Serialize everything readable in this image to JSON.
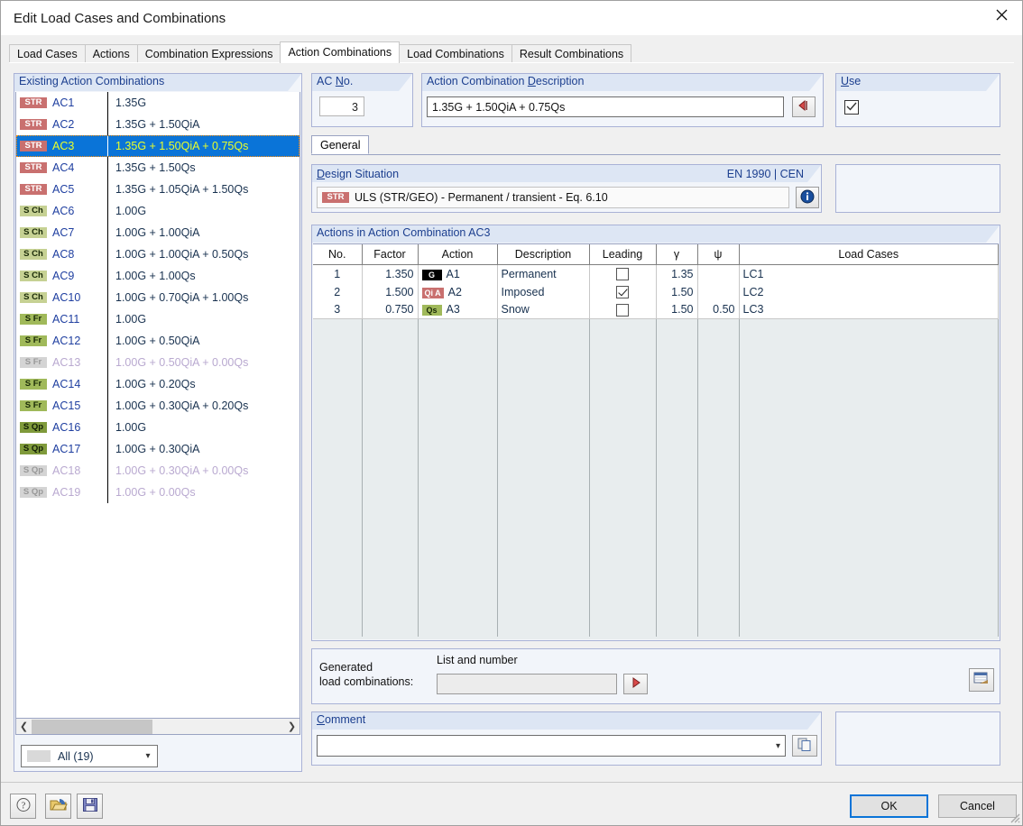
{
  "window": {
    "title": "Edit Load Cases and Combinations",
    "close_icon": "close-icon"
  },
  "tabs": [
    {
      "label": "Load Cases",
      "active": false
    },
    {
      "label": "Actions",
      "active": false
    },
    {
      "label": "Combination Expressions",
      "active": false
    },
    {
      "label": "Action Combinations",
      "active": true
    },
    {
      "label": "Load Combinations",
      "active": false
    },
    {
      "label": "Result Combinations",
      "active": false
    }
  ],
  "existing_panel": {
    "title": "Existing Action Combinations",
    "rows": [
      {
        "badge": "STR",
        "badge_kind": "str",
        "id": "AC1",
        "expr": "1.35G",
        "selected": false,
        "dim": false
      },
      {
        "badge": "STR",
        "badge_kind": "str",
        "id": "AC2",
        "expr": "1.35G + 1.50QiA",
        "selected": false,
        "dim": false
      },
      {
        "badge": "STR",
        "badge_kind": "str",
        "id": "AC3",
        "expr": "1.35G + 1.50QiA + 0.75Qs",
        "selected": true,
        "dim": false
      },
      {
        "badge": "STR",
        "badge_kind": "str",
        "id": "AC4",
        "expr": "1.35G + 1.50Qs",
        "selected": false,
        "dim": false
      },
      {
        "badge": "STR",
        "badge_kind": "str",
        "id": "AC5",
        "expr": "1.35G + 1.05QiA + 1.50Qs",
        "selected": false,
        "dim": false
      },
      {
        "badge": "S Ch",
        "badge_kind": "sch",
        "id": "AC6",
        "expr": "1.00G",
        "selected": false,
        "dim": false
      },
      {
        "badge": "S Ch",
        "badge_kind": "sch",
        "id": "AC7",
        "expr": "1.00G + 1.00QiA",
        "selected": false,
        "dim": false
      },
      {
        "badge": "S Ch",
        "badge_kind": "sch",
        "id": "AC8",
        "expr": "1.00G + 1.00QiA + 0.50Qs",
        "selected": false,
        "dim": false
      },
      {
        "badge": "S Ch",
        "badge_kind": "sch",
        "id": "AC9",
        "expr": "1.00G + 1.00Qs",
        "selected": false,
        "dim": false
      },
      {
        "badge": "S Ch",
        "badge_kind": "sch",
        "id": "AC10",
        "expr": "1.00G + 0.70QiA + 1.00Qs",
        "selected": false,
        "dim": false
      },
      {
        "badge": "S Fr",
        "badge_kind": "sfr",
        "id": "AC11",
        "expr": "1.00G",
        "selected": false,
        "dim": false
      },
      {
        "badge": "S Fr",
        "badge_kind": "sfr",
        "id": "AC12",
        "expr": "1.00G + 0.50QiA",
        "selected": false,
        "dim": false
      },
      {
        "badge": "S Fr",
        "badge_kind": "gray",
        "id": "AC13",
        "expr": "1.00G + 0.50QiA + 0.00Qs",
        "selected": false,
        "dim": true
      },
      {
        "badge": "S Fr",
        "badge_kind": "sfr",
        "id": "AC14",
        "expr": "1.00G + 0.20Qs",
        "selected": false,
        "dim": false
      },
      {
        "badge": "S Fr",
        "badge_kind": "sfr",
        "id": "AC15",
        "expr": "1.00G + 0.30QiA + 0.20Qs",
        "selected": false,
        "dim": false
      },
      {
        "badge": "S Qp",
        "badge_kind": "sqp",
        "id": "AC16",
        "expr": "1.00G",
        "selected": false,
        "dim": false
      },
      {
        "badge": "S Qp",
        "badge_kind": "sqp",
        "id": "AC17",
        "expr": "1.00G + 0.30QiA",
        "selected": false,
        "dim": false
      },
      {
        "badge": "S Qp",
        "badge_kind": "gray",
        "id": "AC18",
        "expr": "1.00G + 0.30QiA + 0.00Qs",
        "selected": false,
        "dim": true
      },
      {
        "badge": "S Qp",
        "badge_kind": "gray",
        "id": "AC19",
        "expr": "1.00G + 0.00Qs",
        "selected": false,
        "dim": true
      }
    ],
    "filter": {
      "label": "All (19)",
      "caret_icon": "chevron-down-icon"
    },
    "scrollbar": {
      "left_icon": "chevron-left-icon",
      "right_icon": "chevron-right-icon"
    }
  },
  "ac_no": {
    "title_pre": "AC ",
    "title_accel": "N",
    "title_post": "o.",
    "value": "3"
  },
  "description": {
    "title_pre": "Action Combination ",
    "title_accel": "D",
    "title_post": "escription",
    "value": "1.35G + 1.50QiA + 0.75Qs",
    "button_icon": "apply-left-arrow-icon"
  },
  "use": {
    "title_accel": "U",
    "title_post": "se",
    "checked": true
  },
  "subtabs": [
    {
      "label": "General",
      "active": true
    }
  ],
  "design_situation": {
    "title_accel": "D",
    "title_post": "esign Situation",
    "standard": "EN 1990 | CEN",
    "badge": "STR",
    "value": "ULS (STR/GEO) - Permanent / transient - Eq. 6.10",
    "info_icon": "info-icon"
  },
  "actions_table": {
    "title": "Actions in Action Combination AC3",
    "columns": [
      "No.",
      "Factor",
      "Action",
      "Description",
      "Leading",
      "γ",
      "ψ",
      "Load Cases"
    ],
    "rows": [
      {
        "no": "1",
        "factor": "1.350",
        "action_badge": "G",
        "action_badge_kind": "g",
        "action": "A1",
        "description": "Permanent",
        "leading": false,
        "gamma": "1.35",
        "psi": "",
        "load_cases": "LC1"
      },
      {
        "no": "2",
        "factor": "1.500",
        "action_badge": "Qi A",
        "action_badge_kind": "qia",
        "action": "A2",
        "description": "Imposed",
        "leading": true,
        "gamma": "1.50",
        "psi": "",
        "load_cases": "LC2"
      },
      {
        "no": "3",
        "factor": "0.750",
        "action_badge": "Qs",
        "action_badge_kind": "qs",
        "action": "A3",
        "description": "Snow",
        "leading": false,
        "gamma": "1.50",
        "psi": "0.50",
        "load_cases": "LC3"
      }
    ]
  },
  "generated": {
    "label_line1": "Generated",
    "label_line2": "load combinations:",
    "sublabel": "List and number",
    "value": "",
    "go_icon": "right-arrow-icon",
    "settings_icon": "table-settings-icon"
  },
  "comment": {
    "title_accel": "C",
    "title_post": "omment",
    "value": "",
    "caret_icon": "chevron-down-icon",
    "button_icon": "copy-icon"
  },
  "footer": {
    "help_icon": "help-icon",
    "open_icon": "open-folder-icon",
    "save_icon": "save-disk-icon",
    "ok_label": "OK",
    "cancel_label": "Cancel"
  }
}
